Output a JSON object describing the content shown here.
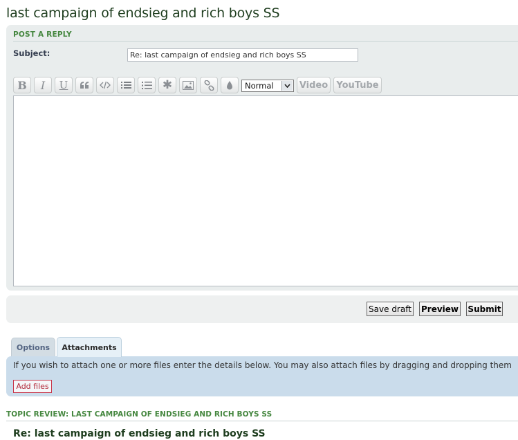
{
  "page": {
    "title": "last campaign of endsieg and rich boys SS"
  },
  "reply": {
    "heading": "POST A REPLY",
    "subject_label": "Subject:",
    "subject_value": "Re: last campaign of endsieg and rich boys SS",
    "message_value": ""
  },
  "toolbar": {
    "buttons": [
      {
        "name": "bold",
        "icon": "bold-icon",
        "label": "B"
      },
      {
        "name": "italic",
        "icon": "italic-icon",
        "label": "I"
      },
      {
        "name": "underline",
        "icon": "underline-icon",
        "label": "U"
      },
      {
        "name": "quote",
        "icon": "quote-icon"
      },
      {
        "name": "code",
        "icon": "code-icon"
      },
      {
        "name": "list",
        "icon": "list-icon"
      },
      {
        "name": "numbered-list",
        "icon": "numbered-list-icon"
      },
      {
        "name": "list-item",
        "icon": "asterisk-icon"
      },
      {
        "name": "image",
        "icon": "image-icon"
      },
      {
        "name": "link",
        "icon": "link-icon"
      },
      {
        "name": "color",
        "icon": "droplet-icon"
      }
    ],
    "font_size_value": "Normal",
    "video_label": "Video",
    "youtube_label": "YouTube"
  },
  "actions": {
    "save_draft_label": "Save draft",
    "preview_label": "Preview",
    "submit_label": "Submit"
  },
  "tabs": {
    "options_label": "Options",
    "attachments_label": "Attachments",
    "active": "Attachments"
  },
  "attachments": {
    "info_text": "If you wish to attach one or more files enter the details below. You may also attach files by dragging and dropping them",
    "add_files_label": "Add files"
  },
  "topic_review": {
    "heading": "TOPIC REVIEW: LAST CAMPAIGN OF ENDSIEG AND RICH BOYS SS",
    "post_title": "Re: last campaign of endsieg and rich boys SS"
  },
  "colors": {
    "title_green": "#1e3d1e",
    "heading_green": "#45873f",
    "panel_gray": "#e9eded",
    "attach_blue": "#cadceb",
    "add_files_red": "#c8364a"
  }
}
